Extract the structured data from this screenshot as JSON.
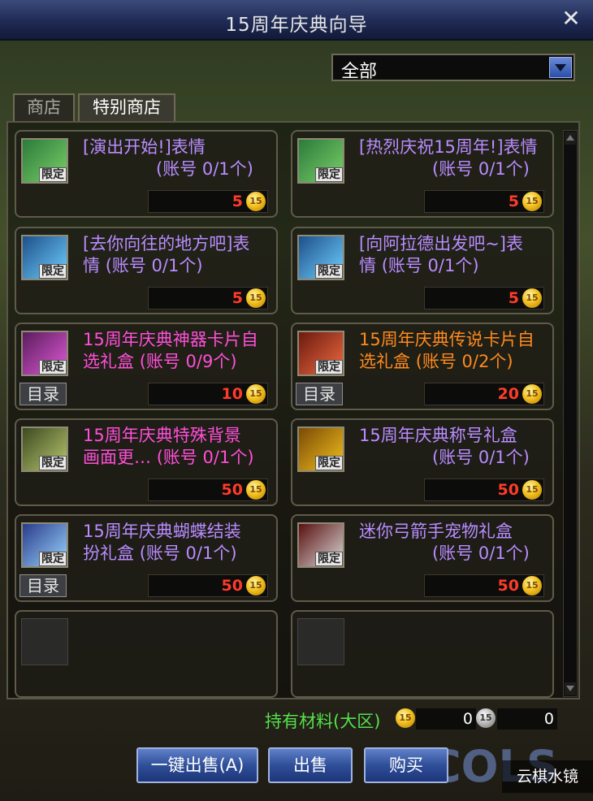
{
  "window": {
    "title": "15周年庆典向导"
  },
  "filter": {
    "selected": "全部"
  },
  "tabs": [
    {
      "label": "商店"
    },
    {
      "label": "特别商店"
    }
  ],
  "items": [
    {
      "name": "[演出开始!]表情",
      "limit": "(账号 0/1个)",
      "price": "5",
      "badge": "限定",
      "color": "#b98cff",
      "catalog": ""
    },
    {
      "name": "[热烈庆祝15周年!]表情",
      "limit": "(账号 0/1个)",
      "price": "5",
      "badge": "限定",
      "color": "#b98cff",
      "catalog": ""
    },
    {
      "name": "[去你向往的地方吧]表",
      "name2": "情",
      "limit": "(账号 0/1个)",
      "price": "5",
      "badge": "限定",
      "color": "#b98cff",
      "catalog": ""
    },
    {
      "name": "[向阿拉德出发吧~]表",
      "name2": "情",
      "limit": "(账号 0/1个)",
      "price": "5",
      "badge": "限定",
      "color": "#b98cff",
      "catalog": ""
    },
    {
      "name": "15周年庆典神器卡片自",
      "name2": "选礼盒",
      "limit": "(账号 0/9个)",
      "price": "10",
      "badge": "限定",
      "color": "#ff4fd8",
      "catalog": "目录"
    },
    {
      "name": "15周年庆典传说卡片自",
      "name2": "选礼盒",
      "limit": "(账号 0/2个)",
      "price": "20",
      "badge": "限定",
      "color": "#ff8a1e",
      "catalog": "目录"
    },
    {
      "name": "15周年庆典特殊背景",
      "name2": "画面更…",
      "limit": "(账号 0/1个)",
      "price": "50",
      "badge": "限定",
      "color": "#ff4fd8",
      "catalog": ""
    },
    {
      "name": "15周年庆典称号礼盒",
      "limit": "(账号 0/1个)",
      "price": "50",
      "badge": "限定",
      "color": "#b98cff",
      "catalog": ""
    },
    {
      "name": "15周年庆典蝴蝶结装",
      "name2": "扮礼盒",
      "limit": "(账号 0/1个)",
      "price": "50",
      "badge": "限定",
      "color": "#b98cff",
      "catalog": "目录"
    },
    {
      "name": "迷你弓箭手宠物礼盒",
      "limit": "(账号 0/1个)",
      "price": "50",
      "badge": "限定",
      "color": "#b98cff",
      "catalog": ""
    }
  ],
  "coin_label": "15",
  "materials": {
    "label": "持有材料(大区)",
    "gold": "0",
    "silver": "0"
  },
  "buttons": {
    "sell_all": "一键出售(A)",
    "sell": "出售",
    "buy": "购买"
  },
  "watermark": "云棋水镜",
  "decor_text": "COLS"
}
